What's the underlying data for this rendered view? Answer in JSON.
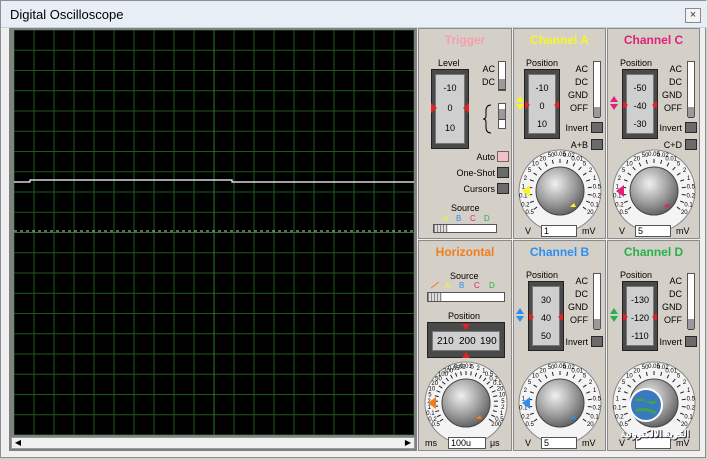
{
  "window": {
    "title": "Digital Oscilloscope",
    "close_glyph": "×"
  },
  "trigger": {
    "title": "Trigger",
    "level_label": "Level",
    "level_scale": [
      "-10",
      "0",
      "10"
    ],
    "ac": "AC",
    "dc": "DC",
    "auto": "Auto",
    "one_shot": "One-Shot",
    "cursors": "Cursors",
    "source_label": "Source",
    "source_channels": [
      "A",
      "B",
      "C",
      "D"
    ]
  },
  "channel_a": {
    "title": "Channel A",
    "position_label": "Position",
    "scale": [
      "-10",
      "0",
      "10"
    ],
    "modes": [
      "AC",
      "DC",
      "GND",
      "OFF"
    ],
    "invert": "Invert",
    "combine": "A+B",
    "dial_ticks": [
      "0.5",
      "0.2",
      "0.1",
      "1",
      "2",
      "5",
      "10",
      "20",
      "50",
      "0.05",
      "0.02",
      "0.01",
      "5",
      "2",
      "1",
      "0.5",
      "0.2",
      "0.1",
      "20"
    ],
    "unit_left": "V",
    "value": "1",
    "unit_right": "mV"
  },
  "channel_c": {
    "title": "Channel C",
    "position_label": "Position",
    "scale": [
      "-50",
      "-40",
      "-30"
    ],
    "modes": [
      "AC",
      "DC",
      "GND",
      "OFF"
    ],
    "invert": "Invert",
    "combine": "C+D",
    "dial_ticks": [
      "0.5",
      "0.2",
      "0.1",
      "1",
      "2",
      "5",
      "10",
      "20",
      "50",
      "0.05",
      "0.02",
      "0.01",
      "5",
      "2",
      "1",
      "0.5",
      "0.2",
      "0.1",
      "20"
    ],
    "unit_left": "V",
    "value": "5",
    "unit_right": "mV"
  },
  "horizontal": {
    "title": "Horizontal",
    "source_label": "Source",
    "source_channels": [
      "A",
      "B",
      "C",
      "D"
    ],
    "position_label": "Position",
    "position_scale": [
      "210",
      "200",
      "190"
    ],
    "dial_ticks": [
      "0.5",
      "0.2",
      "0.1",
      "1",
      "2",
      "5",
      "10",
      "20",
      "50",
      "100",
      "200",
      "0.05",
      "0.02",
      "0.01",
      "5",
      "2",
      "1",
      "0.5",
      "0.2",
      "0.1",
      "20",
      "10",
      "5",
      "2",
      "1",
      "0.5",
      "200"
    ],
    "unit_left": "ms",
    "value": "100u",
    "unit_right": "μs"
  },
  "channel_b": {
    "title": "Channel B",
    "position_label": "Position",
    "scale": [
      "30",
      "40",
      "50"
    ],
    "modes": [
      "AC",
      "DC",
      "GND",
      "OFF"
    ],
    "invert": "Invert",
    "dial_ticks": [
      "0.5",
      "0.2",
      "0.1",
      "1",
      "2",
      "5",
      "10",
      "20",
      "50",
      "0.05",
      "0.02",
      "0.01",
      "5",
      "2",
      "1",
      "0.5",
      "0.2",
      "0.1",
      "20"
    ],
    "unit_left": "V",
    "value": "5",
    "unit_right": "mV"
  },
  "channel_d": {
    "title": "Channel D",
    "position_label": "Position",
    "scale": [
      "-130",
      "-120",
      "-110"
    ],
    "modes": [
      "AC",
      "DC",
      "GND",
      "OFF"
    ],
    "invert": "Invert",
    "dial_ticks": [
      "0.5",
      "0.2",
      "0.1",
      "1",
      "2",
      "5",
      "10",
      "20",
      "50",
      "0.05",
      "0.02",
      "0.01",
      "5",
      "2",
      "1",
      "0.5",
      "0.2",
      "0.1",
      "20"
    ],
    "unit_left": "V",
    "value": "",
    "unit_right": "mV",
    "watermark_text": "القرية الالكترونية"
  },
  "colors": {
    "trigger": "#f4a0b0",
    "channel_a": "#f6f62a",
    "channel_b": "#2b8ef0",
    "channel_c": "#e0207a",
    "channel_d": "#26b04a",
    "horizontal": "#f07d1e",
    "trace": "#ffffff",
    "grid": "#1e5a1e",
    "screen": "#000000"
  }
}
